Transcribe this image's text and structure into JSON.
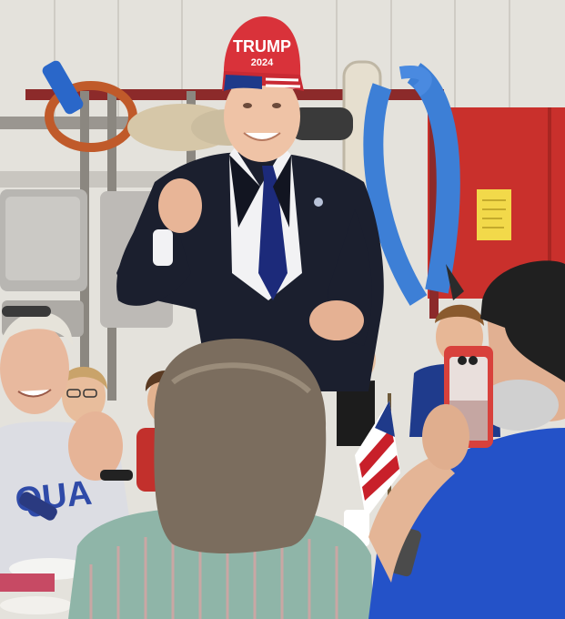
{
  "image": {
    "cap_text_line1": "TRUMP",
    "cap_text_line2": "2024"
  },
  "colors": {
    "wall": "#e4e2dc",
    "red_panel": "#c9302c",
    "cap_red": "#d9323a",
    "suit": "#1b1f2e",
    "tie": "#1c2a7a",
    "shirt": "#f2f2f4",
    "blue_hose": "#3d7fd6",
    "polo_blue": "#2452c8",
    "flag_red": "#c8202a",
    "flag_blue": "#1f3a8a",
    "phone_case": "#d8413c"
  }
}
